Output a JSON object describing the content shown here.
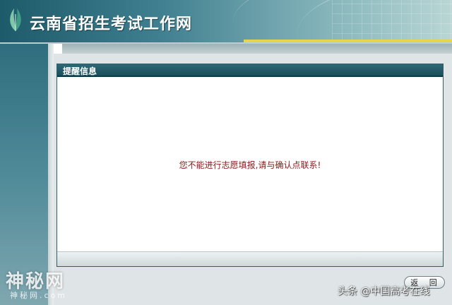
{
  "header": {
    "site_title": "云南省招生考试工作网",
    "logo_icon": "leaf-logo-icon"
  },
  "panel": {
    "title": "提醒信息",
    "message": "您不能进行志愿填报,请与确认点联系!"
  },
  "actions": {
    "back_label": "返 回"
  },
  "watermarks": {
    "left_main": "神秘网",
    "left_sub": "神秘网.com",
    "right": "头条 @中国高考在线"
  },
  "colors": {
    "header_dark": "#1d5a6a",
    "panel_header": "#1d4e5b",
    "message_text": "#8b1a1a",
    "accent_stripe": "#e8d44a"
  }
}
